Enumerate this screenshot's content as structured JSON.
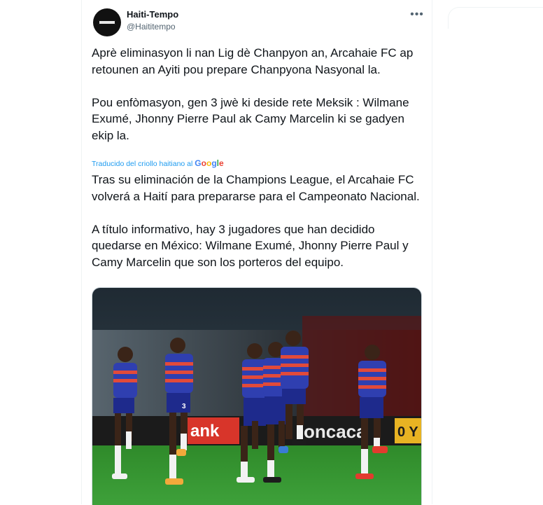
{
  "tweet": {
    "author_name": "Haiti-Tempo",
    "author_handle": "@Haititempo",
    "more_icon": "more-horizontal-icon",
    "original_text": "Aprè eliminasyon li nan Lig dè Chanpyon an, Arcahaie FC ap retounen an Ayiti pou prepare Chanpyona Nasyonal la.\n\nPou enfòmasyon, gen 3 jwè ki deside rete Meksik : Wilmane Exumé, Jhonny Pierre Paul ak Camy Marcelin ki se gadyen ekip la.",
    "translated_by_label": "Traducido del criollo haitiano al",
    "translation_provider": "Google",
    "translated_text": "Tras su eliminación de la Champions League, el Arcahaie FC volverá a Haití para prepararse para el Campeonato Nacional.\n\n A título informativo, hay 3 jugadores que han decidido quedarse en México: Wilmane Exumé, Jhonny Pierre Paul y Camy Marcelin que son los porteros del equipo.",
    "media": {
      "description_icon": "photo-team-warmup",
      "ad_board_text_left": "ank",
      "ad_board_text_right": "oncaca",
      "ad_board_text_far_right": "0 Y",
      "shirt_number": "3"
    }
  },
  "colors": {
    "accent": "#1d9bf0",
    "text": "#0f1419",
    "secondary": "#536471"
  }
}
